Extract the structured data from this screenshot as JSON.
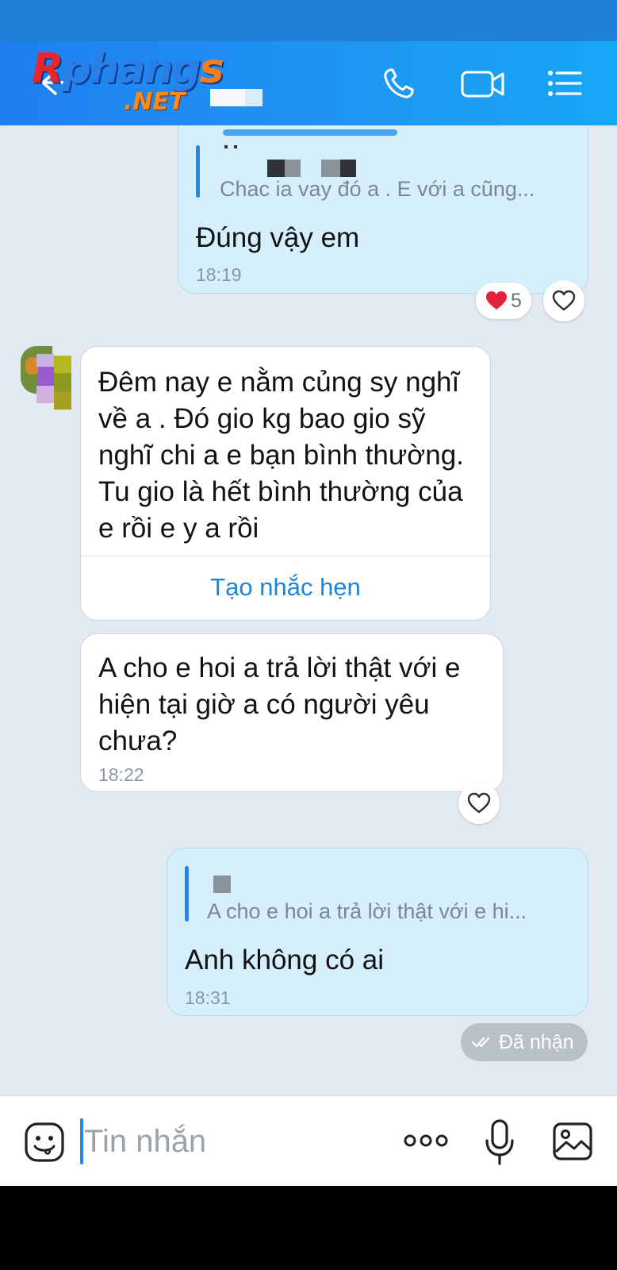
{
  "watermark": {
    "logo_main": "Rphangs",
    "logo_sub": ".NET"
  },
  "header": {
    "icons": [
      "back-icon",
      "phone-icon",
      "video-call-icon",
      "menu-icon"
    ]
  },
  "messages": [
    {
      "id": "m1",
      "side": "sent",
      "quote_text": "Chac ia vay đó a . E với a cũng...",
      "text": "Đúng vậy em",
      "time": "18:19",
      "reaction": {
        "emoji": "heart-icon",
        "count": "5"
      }
    },
    {
      "id": "m2",
      "side": "received",
      "text": "Đêm nay e nằm củng sy nghĩ về a . Đó gio kg bao gio sỹ nghĩ chi a e bạn bình thường. Tu gio là hết bình thường của e rồi e y a rồi",
      "action": "Tạo nhắc hẹn"
    },
    {
      "id": "m3",
      "side": "received",
      "text": "A cho e hoi a trả lời thật với e hiện tại giờ a có người yêu chưa?",
      "time": "18:22"
    },
    {
      "id": "m4",
      "side": "sent",
      "quote_text": "A cho e hoi a trả lời thật với e hi...",
      "text": "Anh không có ai",
      "time": "18:31",
      "status": "Đã nhận"
    }
  ],
  "composer": {
    "placeholder": "Tin nhắn",
    "icons": [
      "sticker-icon",
      "more-options-icon",
      "microphone-icon",
      "image-icon"
    ]
  },
  "colors": {
    "header": "#1f8ff0",
    "sent_bubble": "#d6effd",
    "received_bubble": "#ffffff",
    "chat_background": "#e2e9f1",
    "accent": "#1a86d8"
  }
}
